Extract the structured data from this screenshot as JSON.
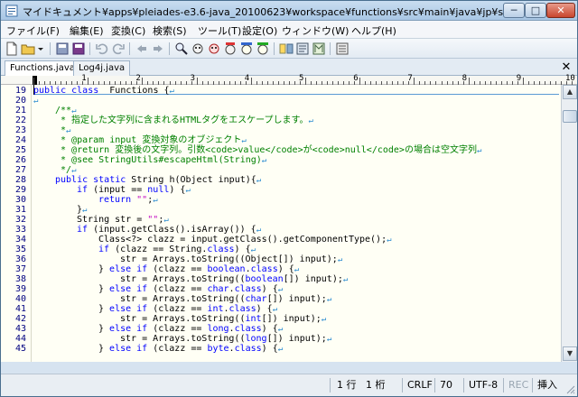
{
  "window": {
    "title": "マイドキュメント¥apps¥pleiades-e3.6-java_20100623¥workspace¥functions¥src¥main¥java¥jp¥sf¥amatera...",
    "min_label": "─",
    "max_label": "□",
    "close_label": "✕"
  },
  "menu": [
    {
      "label": "ファイル(F)"
    },
    {
      "label": "編集(E)"
    },
    {
      "label": "変換(C)"
    },
    {
      "label": "検索(S)"
    },
    {
      "label": "ツール(T)"
    },
    {
      "label": "設定(O)"
    },
    {
      "label": "ウィンドウ(W)"
    },
    {
      "label": "ヘルプ(H)"
    }
  ],
  "toolbar": {
    "buttons": [
      "new-file-icon",
      "open-folder-icon",
      "dropdown-arrow-icon",
      "save-icon",
      "save-all-icon",
      "undo-icon",
      "redo-icon",
      "back-icon",
      "forward-icon",
      "search-icon",
      "search-prev-icon",
      "search-next-icon",
      "replace-icon",
      "grep-icon",
      "jump-icon",
      "compare-icon",
      "outline-icon",
      "macro-icon",
      "settings-icon"
    ]
  },
  "tabs": [
    {
      "label": "Functions.java",
      "active": true
    },
    {
      "label": "Log4j.java",
      "active": false
    }
  ],
  "ruler": {
    "numbers": [
      "1",
      "2",
      "3",
      "4",
      "5",
      "6",
      "7",
      "8",
      "9",
      "10"
    ]
  },
  "editor": {
    "lines": [
      {
        "no": "19",
        "indent": 0,
        "segs": [
          [
            "kw",
            "public class"
          ],
          [
            "",
            "  Functions {"
          ]
        ]
      },
      {
        "no": "20",
        "indent": 0,
        "segs": []
      },
      {
        "no": "21",
        "indent": 1,
        "segs": [
          [
            "cm",
            "/**"
          ]
        ]
      },
      {
        "no": "22",
        "indent": 1,
        "segs": [
          [
            "cm",
            " * 指定した文字列に含まれるHTMLタグをエスケープします。"
          ]
        ]
      },
      {
        "no": "23",
        "indent": 1,
        "segs": [
          [
            "cm",
            " *"
          ]
        ]
      },
      {
        "no": "24",
        "indent": 1,
        "segs": [
          [
            "cm",
            " * @param input 変換対象のオブジェクト"
          ]
        ]
      },
      {
        "no": "25",
        "indent": 1,
        "segs": [
          [
            "cm",
            " * @return 変換後の文字列。引数<code>value</code>が<code>null</code>の場合は空文字列"
          ]
        ]
      },
      {
        "no": "26",
        "indent": 1,
        "segs": [
          [
            "cm",
            " * @see StringUtils#escapeHtml(String)"
          ]
        ]
      },
      {
        "no": "27",
        "indent": 1,
        "segs": [
          [
            "cm",
            " */"
          ]
        ]
      },
      {
        "no": "28",
        "indent": 1,
        "segs": [
          [
            "kw",
            "public static"
          ],
          [
            "",
            " String h(Object input){"
          ]
        ]
      },
      {
        "no": "29",
        "indent": 2,
        "segs": [
          [
            "kw",
            "if"
          ],
          [
            "",
            " (input == "
          ],
          [
            "kw",
            "null"
          ],
          [
            "",
            ") {"
          ]
        ]
      },
      {
        "no": "30",
        "indent": 3,
        "segs": [
          [
            "kw",
            "return"
          ],
          [
            "",
            " "
          ],
          [
            "st",
            "\"\""
          ],
          [
            "",
            ";"
          ]
        ]
      },
      {
        "no": "31",
        "indent": 2,
        "segs": [
          [
            "",
            "}"
          ]
        ]
      },
      {
        "no": "32",
        "indent": 2,
        "segs": [
          [
            "",
            "String str = "
          ],
          [
            "st",
            "\"\""
          ],
          [
            "",
            ";"
          ]
        ]
      },
      {
        "no": "33",
        "indent": 2,
        "segs": [
          [
            "kw",
            "if"
          ],
          [
            "",
            " (input.getClass().isArray()) {"
          ]
        ]
      },
      {
        "no": "34",
        "indent": 3,
        "segs": [
          [
            "",
            "Class<?> clazz = input.getClass().getComponentType();"
          ]
        ]
      },
      {
        "no": "35",
        "indent": 3,
        "segs": [
          [
            "kw",
            "if"
          ],
          [
            "",
            " (clazz == String."
          ],
          [
            "kw",
            "class"
          ],
          [
            "",
            ") {"
          ]
        ]
      },
      {
        "no": "36",
        "indent": 4,
        "segs": [
          [
            "",
            "str = Arrays.toString((Object[]) input);"
          ]
        ]
      },
      {
        "no": "37",
        "indent": 3,
        "segs": [
          [
            "",
            "} "
          ],
          [
            "kw",
            "else if"
          ],
          [
            "",
            " (clazz == "
          ],
          [
            "kw",
            "boolean"
          ],
          [
            "",
            "."
          ],
          [
            "kw",
            "class"
          ],
          [
            "",
            ") {"
          ]
        ]
      },
      {
        "no": "38",
        "indent": 4,
        "segs": [
          [
            "",
            "str = Arrays.toString(("
          ],
          [
            "kw",
            "boolean"
          ],
          [
            "",
            "[]) input);"
          ]
        ]
      },
      {
        "no": "39",
        "indent": 3,
        "segs": [
          [
            "",
            "} "
          ],
          [
            "kw",
            "else if"
          ],
          [
            "",
            " (clazz == "
          ],
          [
            "kw",
            "char"
          ],
          [
            "",
            "."
          ],
          [
            "kw",
            "class"
          ],
          [
            "",
            ") {"
          ]
        ]
      },
      {
        "no": "40",
        "indent": 4,
        "segs": [
          [
            "",
            "str = Arrays.toString(("
          ],
          [
            "kw",
            "char"
          ],
          [
            "",
            "[]) input);"
          ]
        ]
      },
      {
        "no": "41",
        "indent": 3,
        "segs": [
          [
            "",
            "} "
          ],
          [
            "kw",
            "else if"
          ],
          [
            "",
            " (clazz == "
          ],
          [
            "kw",
            "int"
          ],
          [
            "",
            "."
          ],
          [
            "kw",
            "class"
          ],
          [
            "",
            ") {"
          ]
        ]
      },
      {
        "no": "42",
        "indent": 4,
        "segs": [
          [
            "",
            "str = Arrays.toString(("
          ],
          [
            "kw",
            "int"
          ],
          [
            "",
            "[]) input);"
          ]
        ]
      },
      {
        "no": "43",
        "indent": 3,
        "segs": [
          [
            "",
            "} "
          ],
          [
            "kw",
            "else if"
          ],
          [
            "",
            " (clazz == "
          ],
          [
            "kw",
            "long"
          ],
          [
            "",
            "."
          ],
          [
            "kw",
            "class"
          ],
          [
            "",
            ") {"
          ]
        ]
      },
      {
        "no": "44",
        "indent": 4,
        "segs": [
          [
            "",
            "str = Arrays.toString(("
          ],
          [
            "kw",
            "long"
          ],
          [
            "",
            "[]) input);"
          ]
        ]
      },
      {
        "no": "45",
        "indent": 3,
        "segs": [
          [
            "",
            "} "
          ],
          [
            "kw",
            "else if"
          ],
          [
            "",
            " (clazz == "
          ],
          [
            "kw",
            "byte"
          ],
          [
            "",
            "."
          ],
          [
            "kw",
            "class"
          ],
          [
            "",
            ") {"
          ]
        ]
      }
    ],
    "eol_mark": "↵"
  },
  "status": {
    "line": "1 行",
    "col": "1 桁",
    "eol": "CRLF",
    "code": "70",
    "encoding": "UTF-8",
    "rec": "REC",
    "mode": "挿入"
  },
  "colors": {
    "keyword": "#0000ff",
    "comment": "#008000",
    "string": "#c000c0",
    "line_number": "#000080",
    "editor_bg": "#fffff5"
  }
}
